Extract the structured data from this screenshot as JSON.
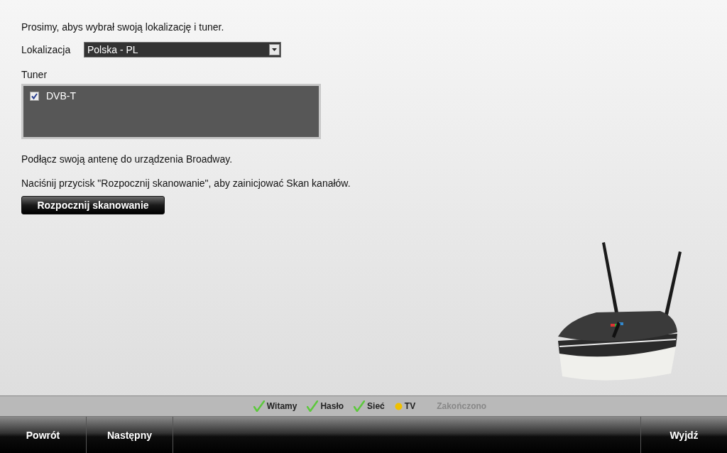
{
  "intro": "Prosimy, abys wybrał swoją lokalizację i tuner.",
  "location": {
    "label": "Lokalizacja",
    "value": "Polska - PL"
  },
  "tuner": {
    "label": "Tuner",
    "options": [
      {
        "label": "DVB-T",
        "checked": true
      }
    ]
  },
  "antenna_note": "Podłącz swoją antenę do urządzenia Broadway.",
  "scan_note": "Naciśnij przycisk \"Rozpocznij skanowanie\", aby zainicjować Skan kanałów.",
  "scan_button": "Rozpocznij skanowanie",
  "steps": [
    {
      "label": "Witamy",
      "kind": "done"
    },
    {
      "label": "Hasło",
      "kind": "done"
    },
    {
      "label": "Sieć",
      "kind": "done"
    },
    {
      "label": "TV",
      "kind": "current"
    },
    {
      "label": "Zakończono",
      "kind": "pending"
    }
  ],
  "nav": {
    "left": [
      "Powrót",
      "Następny"
    ],
    "right": [
      "Wyjdź"
    ]
  }
}
